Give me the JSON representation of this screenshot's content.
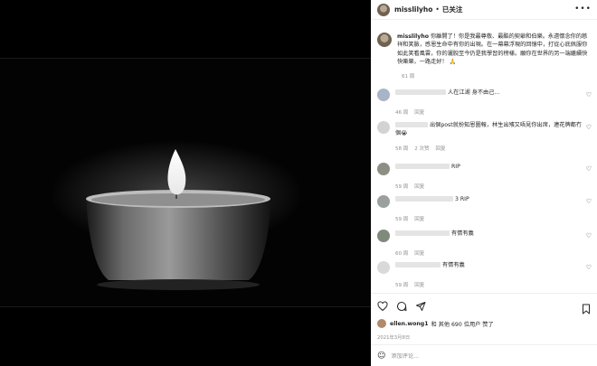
{
  "post": {
    "username": "misslilyho",
    "separator": "•",
    "follow_label": "已关注",
    "more_label": "•••"
  },
  "caption": {
    "username": "misslilyho",
    "text": "你離開了！你是我最尊敬、最酷的契爺和伯樂。永遠懷念你的慈祥和笑臉，感恩生命中有你的出現。在一幕幕浮現的回憶中，打從心底佩服你如此笑看風雲，你的灑脫至今仍是我學習的榜樣。願你在世界的另一端繼續快快樂樂，一路走好！",
    "emoji": "🙏",
    "time": "61 周"
  },
  "comments": [
    {
      "text": "人在江湖 身不由己...",
      "time": "46 周",
      "reply": "回复",
      "likes": ""
    },
    {
      "text": "出個post就扮知恩圖報，林生出殯又唔見你出席，連花牌都冇個😭",
      "time": "58 周",
      "reply": "回复",
      "likes": "2 次赞"
    },
    {
      "text": "RIP",
      "time": "59 周",
      "reply": "回复",
      "likes": ""
    },
    {
      "text": "3 RIP",
      "time": "59 周",
      "reply": "回复",
      "likes": ""
    },
    {
      "text": "有情有義",
      "time": "60 周",
      "reply": "回复",
      "likes": ""
    },
    {
      "text": "有情有義",
      "time": "59 周",
      "reply": "回复",
      "likes": ""
    }
  ],
  "actions": {
    "liked_by_user": "ellen.wong1",
    "liked_suffix": "和 其他 690 位用户 赞了",
    "date": "2021年3月8日",
    "add_comment_placeholder": "添加评论..."
  },
  "icons": {
    "like": "heart-icon",
    "comment": "comment-icon",
    "share": "share-icon",
    "save": "bookmark-icon",
    "emoji": "smiley-icon"
  }
}
